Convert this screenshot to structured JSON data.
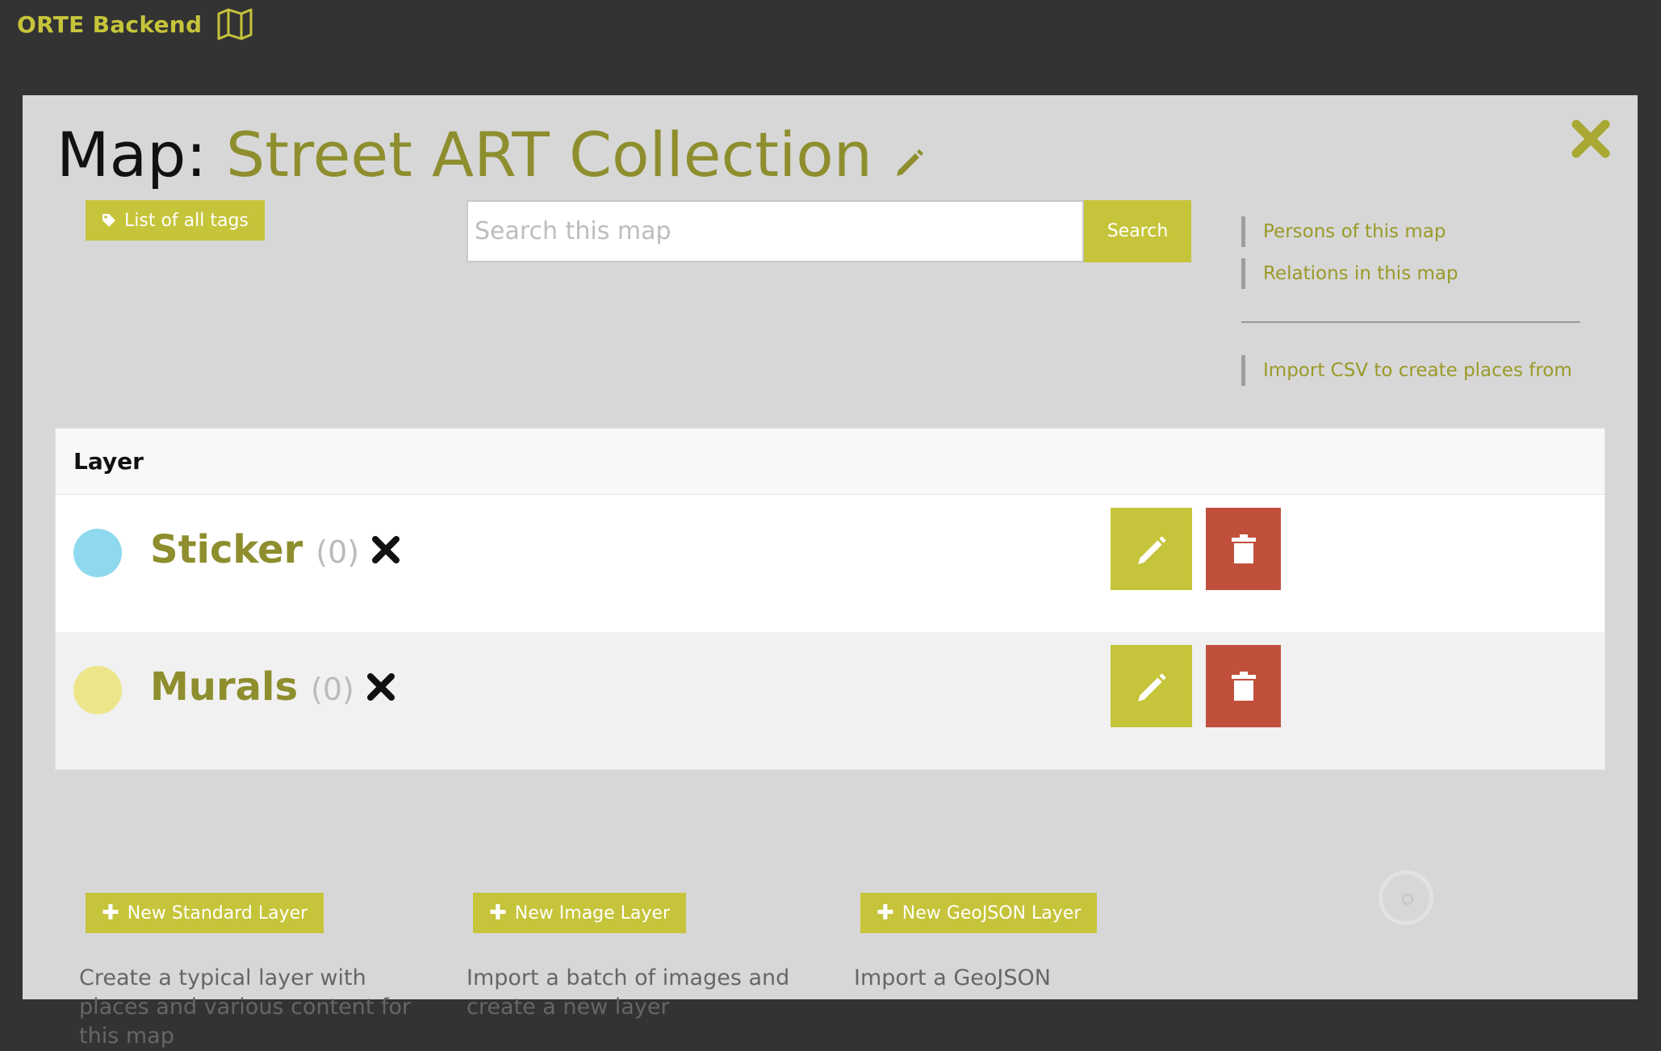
{
  "app": {
    "brand": "ORTE Backend",
    "brand_icon": "map-icon",
    "accent_color": "#c6c43a",
    "danger_color": "#c0503c"
  },
  "page": {
    "title_prefix": "Map:",
    "map_name": "Street ART Collection",
    "edit_icon": "pencil-icon",
    "close_icon": "close-icon"
  },
  "toolbar": {
    "tags_button": "List of all tags",
    "search_placeholder": "Search this map",
    "search_button": "Search"
  },
  "side_links": {
    "persons": "Persons of this map",
    "relations": "Relations in this map",
    "import_csv": "Import CSV to create places from"
  },
  "layers_table": {
    "header": "Layer",
    "rows": [
      {
        "name": "Sticker",
        "count": "(0)",
        "color": "#8fd9ee"
      },
      {
        "name": "Murals",
        "count": "(0)",
        "color": "#ede58a"
      }
    ]
  },
  "new_layers": [
    {
      "button": "New Standard Layer",
      "description": "Create a typical layer with places and various content for this map"
    },
    {
      "button": "New Image Layer",
      "description": "Import a batch of images and create a new layer"
    },
    {
      "button": "New GeoJSON Layer",
      "description": "Import a GeoJSON"
    }
  ]
}
